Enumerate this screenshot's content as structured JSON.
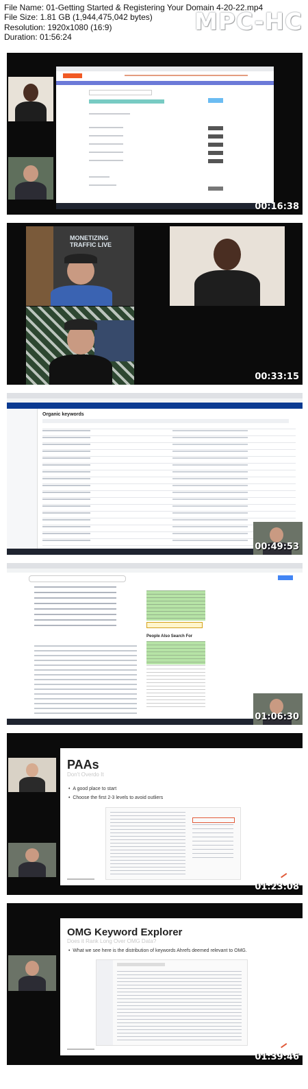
{
  "info": {
    "file_name": "File Name: 01-Getting Started & Registering Your Domain 4-20-22.mp4",
    "file_size": "File Size: 1.81 GB (1,944,475,042 bytes)",
    "resolution": "Resolution: 1920x1080 (16:9)",
    "duration": "Duration: 01:56:24"
  },
  "brand": "MPC-HC",
  "thumbnails": [
    {
      "timestamp": "00:16:38",
      "scene": "namecheap-domain-search"
    },
    {
      "timestamp": "00:33:15",
      "scene": "webcam-grid",
      "poster_text": "MONETIZING TRAFFIC LIVE"
    },
    {
      "timestamp": "00:49:53",
      "scene": "ahrefs-organic-keywords",
      "heading": "Organic keywords"
    },
    {
      "timestamp": "01:06:30",
      "scene": "google-search-paa",
      "paa_label": "People Also Search For"
    },
    {
      "timestamp": "01:23:08",
      "scene": "slide",
      "title": "PAAs",
      "subtitle": "Don't Overdo It",
      "bullets": [
        "A good place to start",
        "Choose the first 2-3 levels to avoid outliers"
      ]
    },
    {
      "timestamp": "01:39:46",
      "scene": "slide",
      "title": "OMG Keyword Explorer",
      "subtitle": "Does it Rank Long Over OMG Data?",
      "bullets": [
        "What we see here is the distribution of keywords Ahrefs deemed relevant to OMG."
      ]
    }
  ],
  "colors": {
    "namecheap_orange": "#f15a24",
    "ahrefs_blue": "#0b3a91",
    "paa_green": "#b6e3a6",
    "slide_accent": "#e15b3a"
  }
}
